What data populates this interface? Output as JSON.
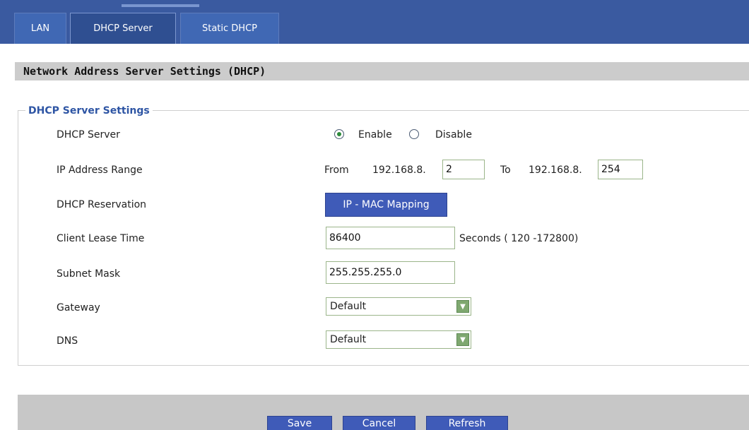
{
  "tabs": [
    {
      "label": "LAN",
      "active": false
    },
    {
      "label": "DHCP Server",
      "active": true
    },
    {
      "label": "Static DHCP",
      "active": false
    }
  ],
  "section_title": "Network Address Server Settings (DHCP)",
  "fieldset": {
    "legend": "DHCP Server Settings",
    "dhcp_server": {
      "label": "DHCP Server",
      "enable": "Enable",
      "disable": "Disable",
      "selected": "Enable"
    },
    "ip_range": {
      "label": "IP Address Range",
      "from": "From",
      "prefix_from": "192.168.8.",
      "start": "2",
      "to": "To",
      "prefix_to": "192.168.8.",
      "end": "254"
    },
    "reservation": {
      "label": "DHCP Reservation",
      "button": "IP - MAC Mapping"
    },
    "lease": {
      "label": "Client Lease Time",
      "value": "86400",
      "hint": "Seconds ( 120 -172800)"
    },
    "subnet": {
      "label": "Subnet Mask",
      "value": "255.255.255.0"
    },
    "gateway": {
      "label": "Gateway",
      "selected": "Default"
    },
    "dns": {
      "label": "DNS",
      "selected": "Default"
    }
  },
  "buttons": {
    "save": "Save",
    "cancel": "Cancel",
    "refresh": "Refresh"
  },
  "colors": {
    "tab_bar": "#3a5aa0",
    "legend_text": "#2e55a4",
    "button_blue": "#3f5bb8"
  }
}
